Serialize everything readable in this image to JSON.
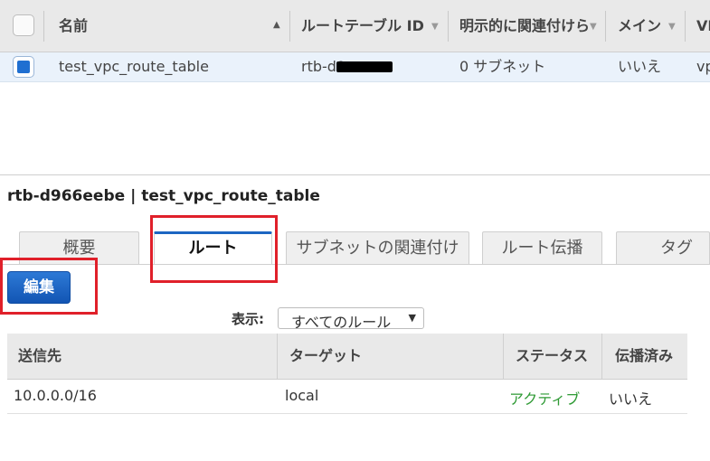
{
  "top_table": {
    "columns": [
      "名前",
      "ルートテーブル ID",
      "明示的に関連付けら",
      "メイン",
      "VP"
    ],
    "row": {
      "name": "test_vpc_route_table",
      "route_table_id": "rtb-d9",
      "explicit_assoc": "0 サブネット",
      "main": "いいえ",
      "vpc": "vp"
    }
  },
  "detail": {
    "title": "rtb-d966eebe | test_vpc_route_table",
    "tabs": [
      "概要",
      "ルート",
      "サブネットの関連付け",
      "ルート伝播",
      "タグ"
    ],
    "active_tab": "ルート",
    "edit_label": "編集",
    "show_label": "表示:",
    "filter_value": "すべてのルール",
    "routes_columns": [
      "送信先",
      "ターゲット",
      "ステータス",
      "伝播済み"
    ],
    "routes": [
      {
        "destination": "10.0.0.0/16",
        "target": "local",
        "status": "アクティブ",
        "propagated": "いいえ"
      }
    ]
  },
  "colors": {
    "status_active": "#2e9a34",
    "primary_button": "#1c66c2",
    "highlight_box": "#e0202a",
    "selected_row": "#eaf2fb"
  }
}
